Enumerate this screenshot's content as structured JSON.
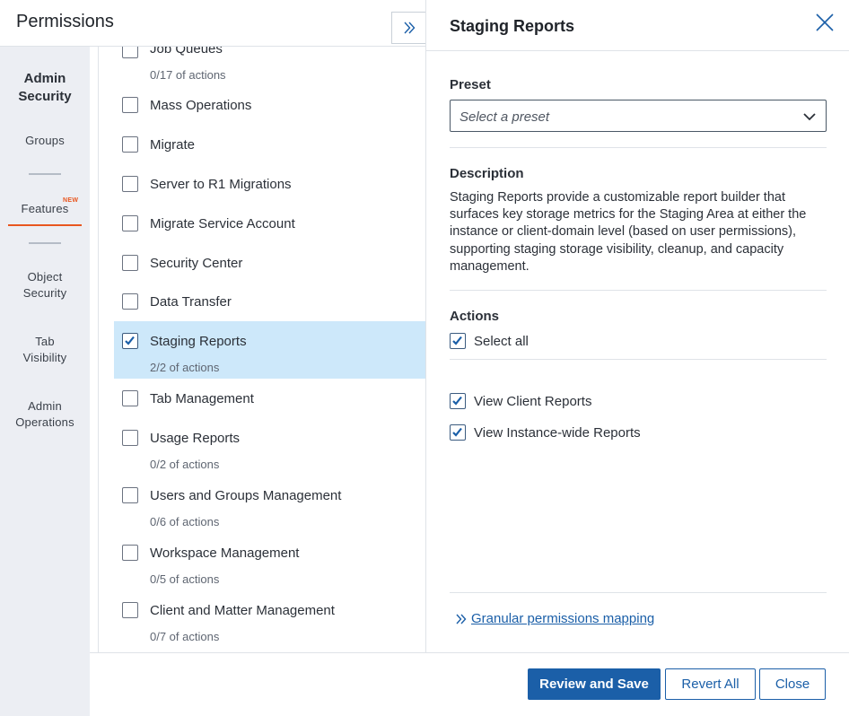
{
  "header": {
    "title": "Permissions"
  },
  "nav": {
    "admin_security": "Admin Security",
    "groups": "Groups",
    "features": "Features",
    "features_badge": "NEW",
    "object_security": "Object Security",
    "tab_visibility": "Tab Visibility",
    "admin_operations": "Admin Operations"
  },
  "features": [
    {
      "label": "Job Queues",
      "sub": "0/17 of actions",
      "checked": false
    },
    {
      "label": "Mass Operations",
      "sub": "",
      "checked": false
    },
    {
      "label": "Migrate",
      "sub": "",
      "checked": false
    },
    {
      "label": "Server to R1 Migrations",
      "sub": "",
      "checked": false
    },
    {
      "label": "Migrate Service Account",
      "sub": "",
      "checked": false
    },
    {
      "label": "Security Center",
      "sub": "",
      "checked": false
    },
    {
      "label": "Data Transfer",
      "sub": "",
      "checked": false
    },
    {
      "label": "Staging Reports",
      "sub": "2/2 of actions",
      "checked": true
    },
    {
      "label": "Tab Management",
      "sub": "",
      "checked": false
    },
    {
      "label": "Usage Reports",
      "sub": "0/2 of actions",
      "checked": false
    },
    {
      "label": "Users and Groups Management",
      "sub": "0/6 of actions",
      "checked": false
    },
    {
      "label": "Workspace Management",
      "sub": "0/5 of actions",
      "checked": false
    },
    {
      "label": "Client and Matter Management",
      "sub": "0/7 of actions",
      "checked": false
    }
  ],
  "detail": {
    "title": "Staging Reports",
    "preset_label": "Preset",
    "preset_placeholder": "Select a preset",
    "description_label": "Description",
    "description": "Staging Reports provide a customizable report builder that surfaces key storage metrics for the Staging Area at either the instance or client-domain level (based on user permissions), supporting staging storage visibility, cleanup, and capacity management.",
    "actions_label": "Actions",
    "select_all": "Select all",
    "actions": [
      {
        "label": "View Client Reports",
        "checked": true
      },
      {
        "label": "View Instance-wide Reports",
        "checked": true
      }
    ],
    "granular_link": "Granular permissions mapping"
  },
  "footer": {
    "review_save": "Review and Save",
    "revert_all": "Revert All",
    "close": "Close"
  },
  "colors": {
    "accent": "#1b5fa8",
    "selected_row": "#cde8fa",
    "badge": "#e8561f",
    "nav_bg": "#eceef3"
  }
}
